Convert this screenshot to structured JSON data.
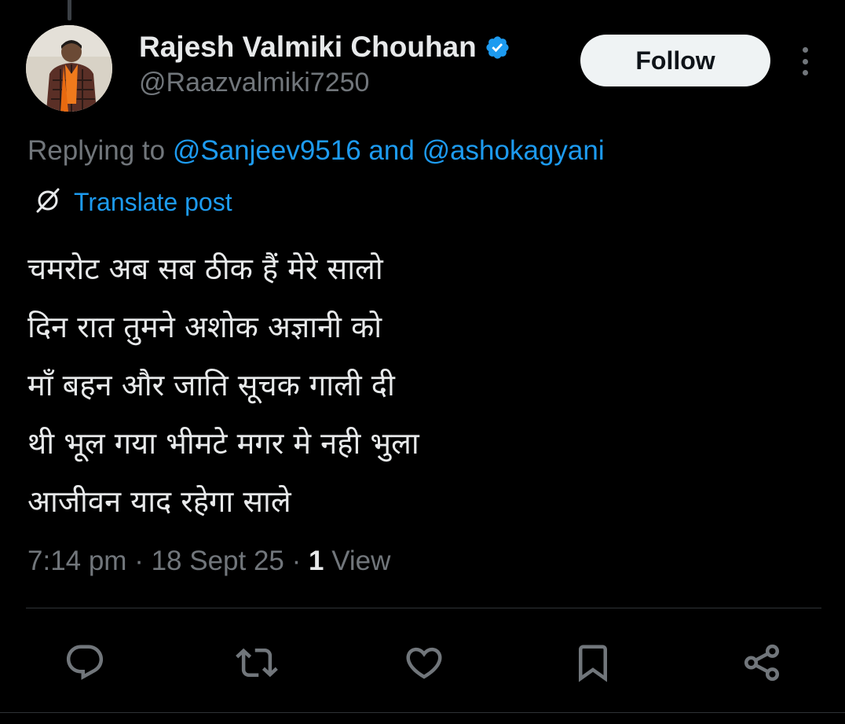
{
  "author": {
    "display_name": "Rajesh Valmiki Chouhan",
    "handle": "@Raazvalmiki7250",
    "verified": true
  },
  "header": {
    "follow_label": "Follow"
  },
  "reply": {
    "prefix": "Replying to ",
    "mention_1": "@Sanjeev9516",
    "conjunction": " and ",
    "mention_2": "@ashokagyani"
  },
  "translate_label": "Translate post",
  "post_lines": [
    "चमरोट अब सब ठीक हैं मेरे सालो",
    "दिन रात तुमने अशोक अज्ञानी को",
    "माँ बहन और जाति सूचक गाली दी",
    "थी भूल गया भीमटे मगर मे नही भुला",
    "आजीवन याद रहेगा साले"
  ],
  "meta": {
    "time": "7:14 pm",
    "separator": " · ",
    "date": "18 Sept 25",
    "view_count": "1",
    "view_label": " View"
  },
  "actions": [
    {
      "icon": "reply-icon"
    },
    {
      "icon": "repost-icon"
    },
    {
      "icon": "like-icon"
    },
    {
      "icon": "bookmark-icon"
    },
    {
      "icon": "share-icon"
    }
  ],
  "colors": {
    "background": "#000000",
    "text": "#e7e9ea",
    "secondary": "#71767b",
    "link": "#1d9bf0",
    "verified": "#1d9bf0",
    "divider": "#2f3336"
  }
}
